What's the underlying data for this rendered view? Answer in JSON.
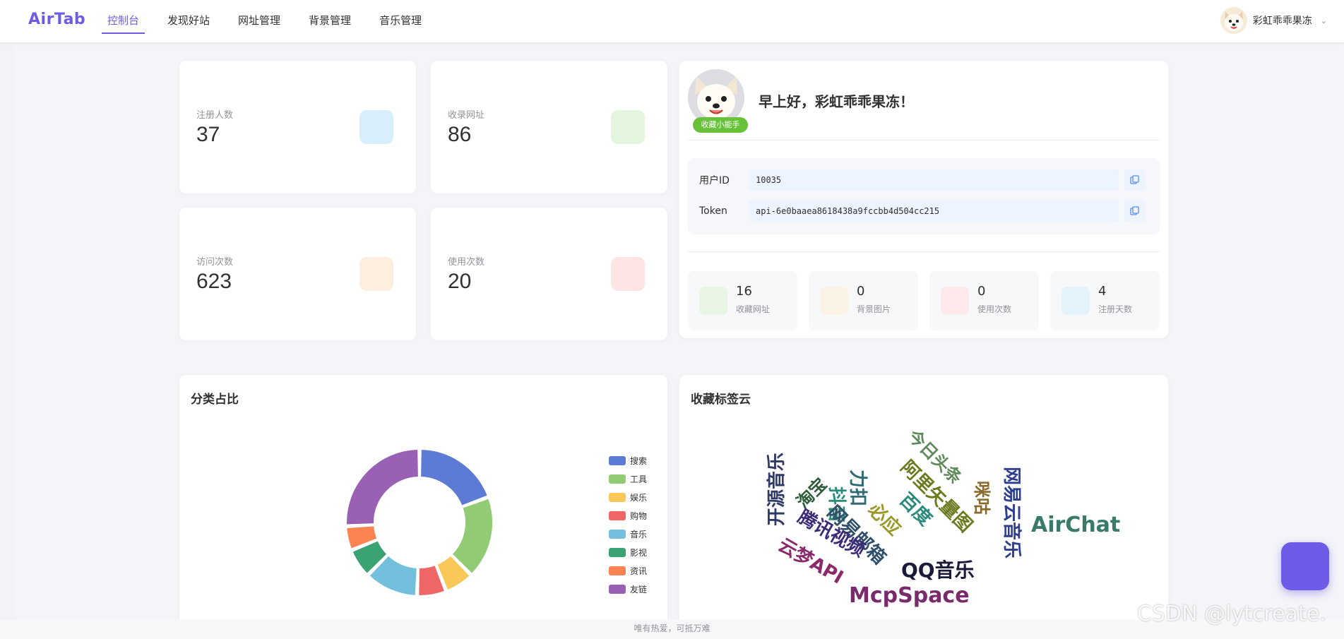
{
  "brand": "AirTab",
  "nav": [
    {
      "label": "控制台",
      "active": true
    },
    {
      "label": "发现好站",
      "active": false
    },
    {
      "label": "网址管理",
      "active": false
    },
    {
      "label": "背景管理",
      "active": false
    },
    {
      "label": "音乐管理",
      "active": false
    }
  ],
  "user": {
    "name": "彩虹乖乖果冻"
  },
  "stats": [
    {
      "label": "注册人数",
      "value": "37",
      "color": "#d9eefb"
    },
    {
      "label": "收录网址",
      "value": "86",
      "color": "#e3f5dc"
    },
    {
      "label": "访问次数",
      "value": "623",
      "color": "#fcefdf"
    },
    {
      "label": "使用次数",
      "value": "20",
      "color": "#fde5e5"
    }
  ],
  "profile": {
    "badge": "收藏小能手",
    "greeting": "早上好，彩虹乖乖果冻！",
    "user_id_label": "用户ID",
    "user_id": "10035",
    "token_label": "Token",
    "token": "api-6e0baaea8618438a9fccbb4d504cc215",
    "mini_stats": [
      {
        "value": "16",
        "label": "收藏网址",
        "color": "#e8f5e2"
      },
      {
        "value": "0",
        "label": "背景图片",
        "color": "#fbf3e6"
      },
      {
        "value": "0",
        "label": "使用次数",
        "color": "#fde9ea"
      },
      {
        "value": "4",
        "label": "注册天数",
        "color": "#e3f2fb"
      }
    ]
  },
  "pie_card": {
    "title": "分类占比"
  },
  "chart_data": {
    "type": "pie",
    "categories": [
      "搜索",
      "工具",
      "娱乐",
      "购物",
      "音乐",
      "影视",
      "资讯",
      "友链"
    ],
    "values": [
      18,
      17,
      6,
      6,
      11,
      6,
      5,
      24
    ],
    "colors": [
      "#5b7bd5",
      "#91cc75",
      "#fac858",
      "#ee6666",
      "#73c0de",
      "#3ba272",
      "#fc8452",
      "#9a60b4"
    ],
    "donut": true,
    "legend": "right"
  },
  "tag_card": {
    "title": "收藏标签云"
  },
  "tag_cloud": [
    {
      "text": "开源音乐",
      "color": "#2f3b66"
    },
    {
      "text": "淘宝",
      "color": "#2e5c3b"
    },
    {
      "text": "抖音",
      "color": "#2b8a7a"
    },
    {
      "text": "力扣",
      "color": "#2f6b74"
    },
    {
      "text": "今日头条",
      "color": "#5f8a5a"
    },
    {
      "text": "阿里矢量图",
      "color": "#6a7a1e"
    },
    {
      "text": "咪咕",
      "color": "#8a6a2a"
    },
    {
      "text": "网易云音乐",
      "color": "#2e3f8f"
    },
    {
      "text": "网易邮箱",
      "color": "#2e4f6a"
    },
    {
      "text": "必应",
      "color": "#9a9a2a"
    },
    {
      "text": "百度",
      "color": "#2b8a7a"
    },
    {
      "text": "AirChat",
      "color": "#3a7a6a"
    },
    {
      "text": "腾讯视频",
      "color": "#3a2a7a"
    },
    {
      "text": "云梦API",
      "color": "#8a2a6a"
    },
    {
      "text": "QQ音乐",
      "color": "#1a1a3a"
    },
    {
      "text": "McpSpace",
      "color": "#7a2a6a"
    }
  ],
  "footer": "唯有热爱，可抵万难",
  "watermark": "CSDN @lytcreate."
}
